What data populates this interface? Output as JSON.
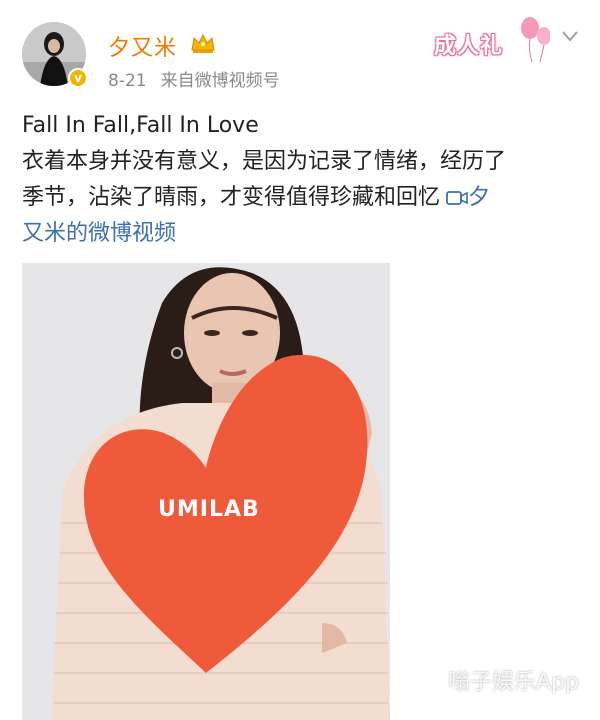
{
  "header": {
    "username": "夕又米",
    "time": "8-21",
    "source": "来自微博视频号",
    "badge_text": "成人礼"
  },
  "post": {
    "line1": "Fall In Fall,Fall In Love",
    "line2": "衣着本身并没有意义，是因为记录了情绪，经历了",
    "line3": "季节，沾染了晴雨，才变得值得珍藏和回忆",
    "link_part1": "夕",
    "link_part2": "又米的微博视频"
  },
  "image": {
    "brand_text": "UMILAB"
  },
  "watermark": "嗡子娱乐App",
  "colors": {
    "username": "#f07a00",
    "meta": "#8a8a8a",
    "link": "#3f6fb2",
    "heart": "#ef5a3a"
  }
}
